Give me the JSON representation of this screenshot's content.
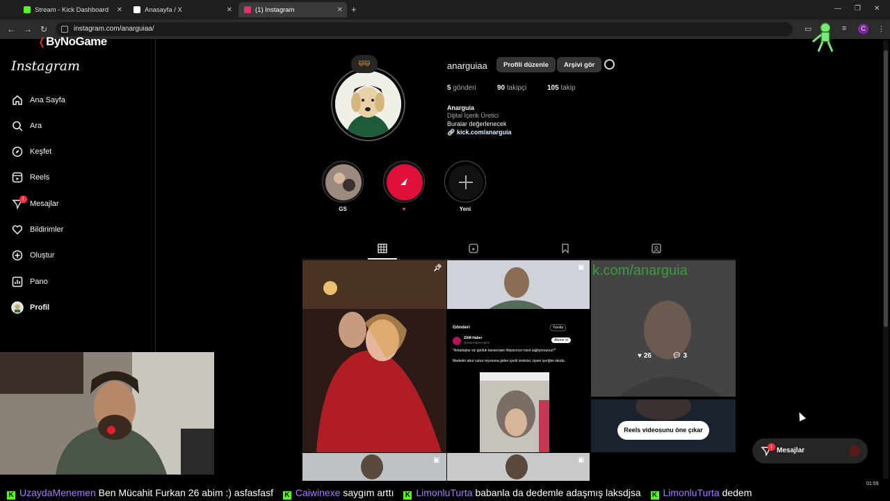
{
  "browser": {
    "tabs": [
      {
        "title": "Stream - Kick Dashboard",
        "favicon_color": "#53fc18"
      },
      {
        "title": "Anasayfa / X",
        "favicon_color": "#ffffff"
      },
      {
        "title": "(1) Instagram",
        "favicon_color": "#e1306c"
      }
    ],
    "new_tab": "+",
    "url": "instagram.com/anarguiaa/",
    "profile_initial": "C",
    "window_controls": {
      "minimize": "—",
      "restore": "❐",
      "close": "✕"
    }
  },
  "overlay": {
    "watermark": "ByNoGame",
    "ticker": [
      {
        "user": "UzaydaMenemen",
        "msg": "Ben Mücahit Furkan 26 abim :) asfasfasf"
      },
      {
        "user": "Caiwinexe",
        "msg": "saygım arttı"
      },
      {
        "user": "LimonluTurta",
        "msg": "babanla da dedemle adaşmış laksdjsa"
      },
      {
        "user": "LimonluTurta",
        "msg": "dedem"
      }
    ],
    "clock": "01:59"
  },
  "instagram": {
    "logo": "Instagram",
    "nav": [
      {
        "label": "Ana Sayfa",
        "icon": "home-icon"
      },
      {
        "label": "Ara",
        "icon": "search-icon"
      },
      {
        "label": "Keşfet",
        "icon": "compass-icon"
      },
      {
        "label": "Reels",
        "icon": "reels-icon"
      },
      {
        "label": "Mesajlar",
        "icon": "messenger-icon",
        "badge": "1"
      },
      {
        "label": "Bildirimler",
        "icon": "heart-icon"
      },
      {
        "label": "Oluştur",
        "icon": "plus-square-icon"
      },
      {
        "label": "Pano",
        "icon": "dashboard-icon"
      },
      {
        "label": "Profil",
        "icon": "avatar-icon"
      }
    ],
    "profile": {
      "note": "🐱🐱",
      "username": "anarguiaa",
      "edit_button": "Profili düzenle",
      "archive_button": "Arşivi gör",
      "stats": {
        "posts": "5",
        "posts_label": "gönderi",
        "followers": "90",
        "followers_label": "takipçi",
        "following": "105",
        "following_label": "takip"
      },
      "name": "Anarguia",
      "category": "Dijital İçerik Üretici",
      "bio": "Buralar değerlenecek",
      "link": "kick.com/anarguia"
    },
    "highlights": [
      {
        "label": "GS"
      },
      {
        "label": "♥"
      },
      {
        "label": "Yeni"
      }
    ],
    "grid": {
      "post1_likes": "26",
      "post1_comments": "3",
      "tweet": {
        "header": "Gönderi",
        "reply": "Yanıtla",
        "account": "ZAM Haber",
        "handle": "@ZamHaberAjans",
        "follow": "Abone ol",
        "quote": "\"Arkadaşlar siz günlük kanserojen ihtiyacınızı nasıl sağlıyorsunuz?\"",
        "text": "Marketin abur cubur reyonuna giden içerik üreticisi, cipsin içeriğini okudu."
      },
      "watermark_text": "k.com/anarguia",
      "feature_reel": "Reels videosunu öne çıkar"
    },
    "messages_pill": {
      "label": "Mesajlar",
      "badge": "1"
    }
  },
  "colors": {
    "accent_kick": "#53fc18",
    "badge_red": "#ff3040",
    "ticker_user": "#a67cff"
  }
}
